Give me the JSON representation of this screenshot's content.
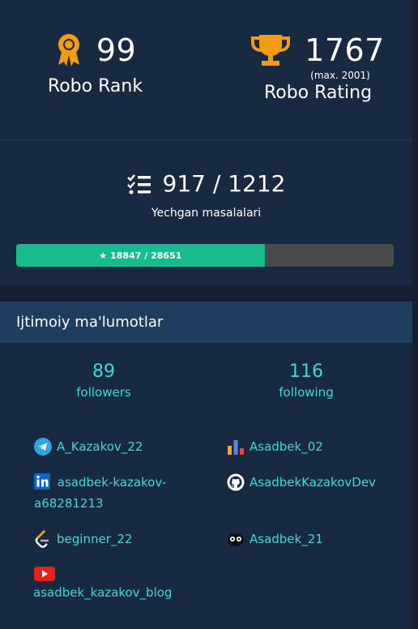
{
  "robo_rank": {
    "value": "99",
    "label": "Robo Rank"
  },
  "robo_rating": {
    "value": "1767",
    "max_note": "(max. 2001)",
    "label": "Robo Rating"
  },
  "solved": {
    "value": "917 / 1212",
    "label": "Yechgan masalalari"
  },
  "points_progress": {
    "text": "18847 / 28651",
    "fraction": 0.658
  },
  "social": {
    "title": "Ijtimoiy ma'lumotlar",
    "followers_count": "89",
    "followers_label": "followers",
    "following_count": "116",
    "following_label": "following",
    "telegram": "A_Kazakov_22",
    "analytics": "Asadbek_02",
    "linkedin": "asadbek-kazakov-a68281213",
    "github": "AsadbekKazakovDev",
    "leetcode": "beginner_22",
    "codeforces": "Asadbek_21",
    "youtube": "asadbek_kazakov_blog"
  },
  "colors": {
    "accent": "#f39c12",
    "teal": "#3fd9d4",
    "progress": "#18bc8c",
    "panel": "#172a41"
  }
}
